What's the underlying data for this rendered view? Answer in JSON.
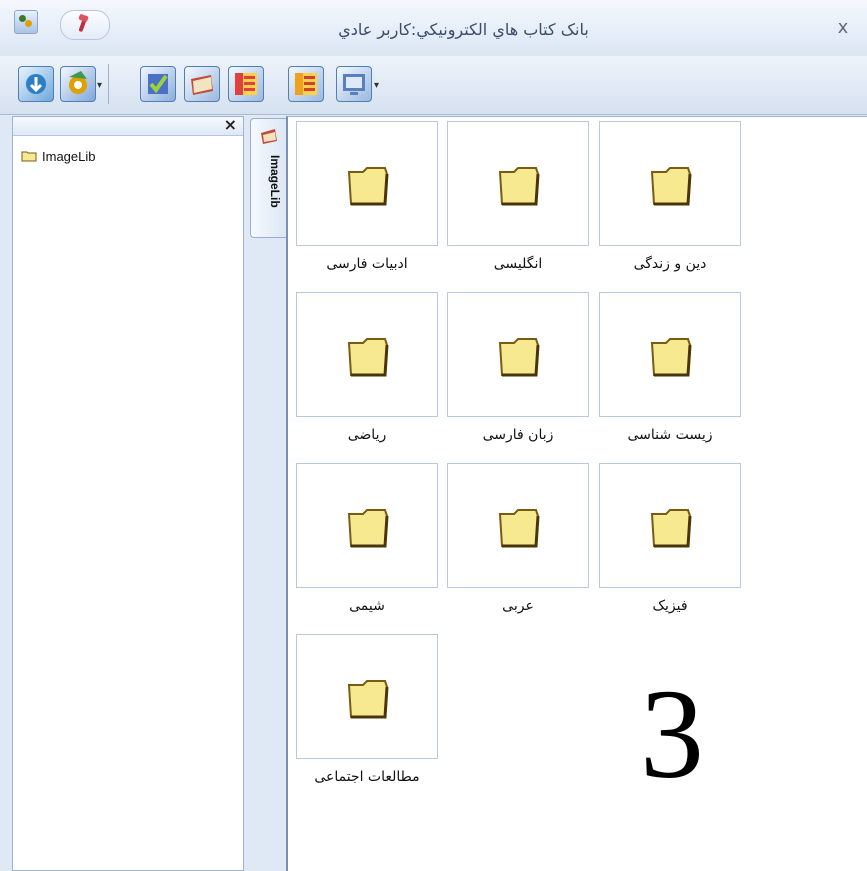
{
  "window": {
    "title": "بانک کتاب هاي الکترونيکي:کاربر عادي",
    "close_glyph": "x"
  },
  "toolbar": {
    "buttons": [
      {
        "name": "download-icon",
        "color": "#2d7fc4"
      },
      {
        "name": "settings-icon",
        "color": "#3d9a4c"
      },
      {
        "name": "check-icon",
        "color": "#4c6fc8"
      },
      {
        "name": "book-icon",
        "color": "#c34a3a"
      },
      {
        "name": "list-icon",
        "color": "#e04040"
      },
      {
        "name": "list-alt-icon",
        "color": "#f0a020"
      },
      {
        "name": "monitor-icon",
        "color": "#5a7fc0"
      }
    ]
  },
  "left_panel": {
    "close_glyph": "×",
    "tree": [
      {
        "label": "ImageLib"
      }
    ]
  },
  "tab": {
    "label": "ImageLib"
  },
  "folders": [
    {
      "label": "دين و زندگی"
    },
    {
      "label": "انگليسی"
    },
    {
      "label": "ادبيات فارسی"
    },
    {
      "label": "زيست شناسی"
    },
    {
      "label": "زبان فارسی"
    },
    {
      "label": "رياضی"
    },
    {
      "label": "فيزيک"
    },
    {
      "label": "عربی"
    },
    {
      "label": "شيمی"
    },
    {
      "label": "مطالعات اجتماعی"
    }
  ],
  "overlay_number": "3",
  "colors": {
    "folder_fill": "#f7e98f",
    "folder_stroke": "#7a5b12",
    "accent": "#9fb3cd"
  }
}
